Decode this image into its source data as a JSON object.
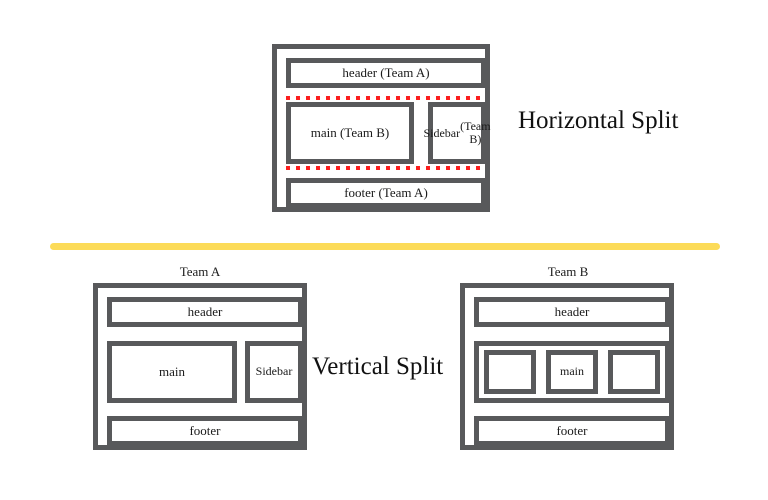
{
  "colors": {
    "box_border": "#58595b",
    "dotted_rule": "#fb1e1e",
    "divider": "#fcdb58",
    "background": "#ffffff",
    "text": "#1a1a1a"
  },
  "horizontal_split": {
    "caption": "Horizontal Split",
    "header": "header (Team A)",
    "main": "main (Team B)",
    "sidebar_line1": "Sidebar",
    "sidebar_line2": "(Team B)",
    "footer": "footer (Team A)",
    "divider_style": "red-dotted"
  },
  "divider": {
    "style": "solid-yellow-rule"
  },
  "vertical_split": {
    "caption": "Vertical Split",
    "team_a": {
      "label": "Team A",
      "header": "header",
      "main": "main",
      "sidebar": "Sidebar",
      "footer": "footer"
    },
    "team_b": {
      "label": "Team B",
      "header": "header",
      "slot_left": "",
      "main": "main",
      "slot_right": "",
      "footer": "footer"
    }
  }
}
